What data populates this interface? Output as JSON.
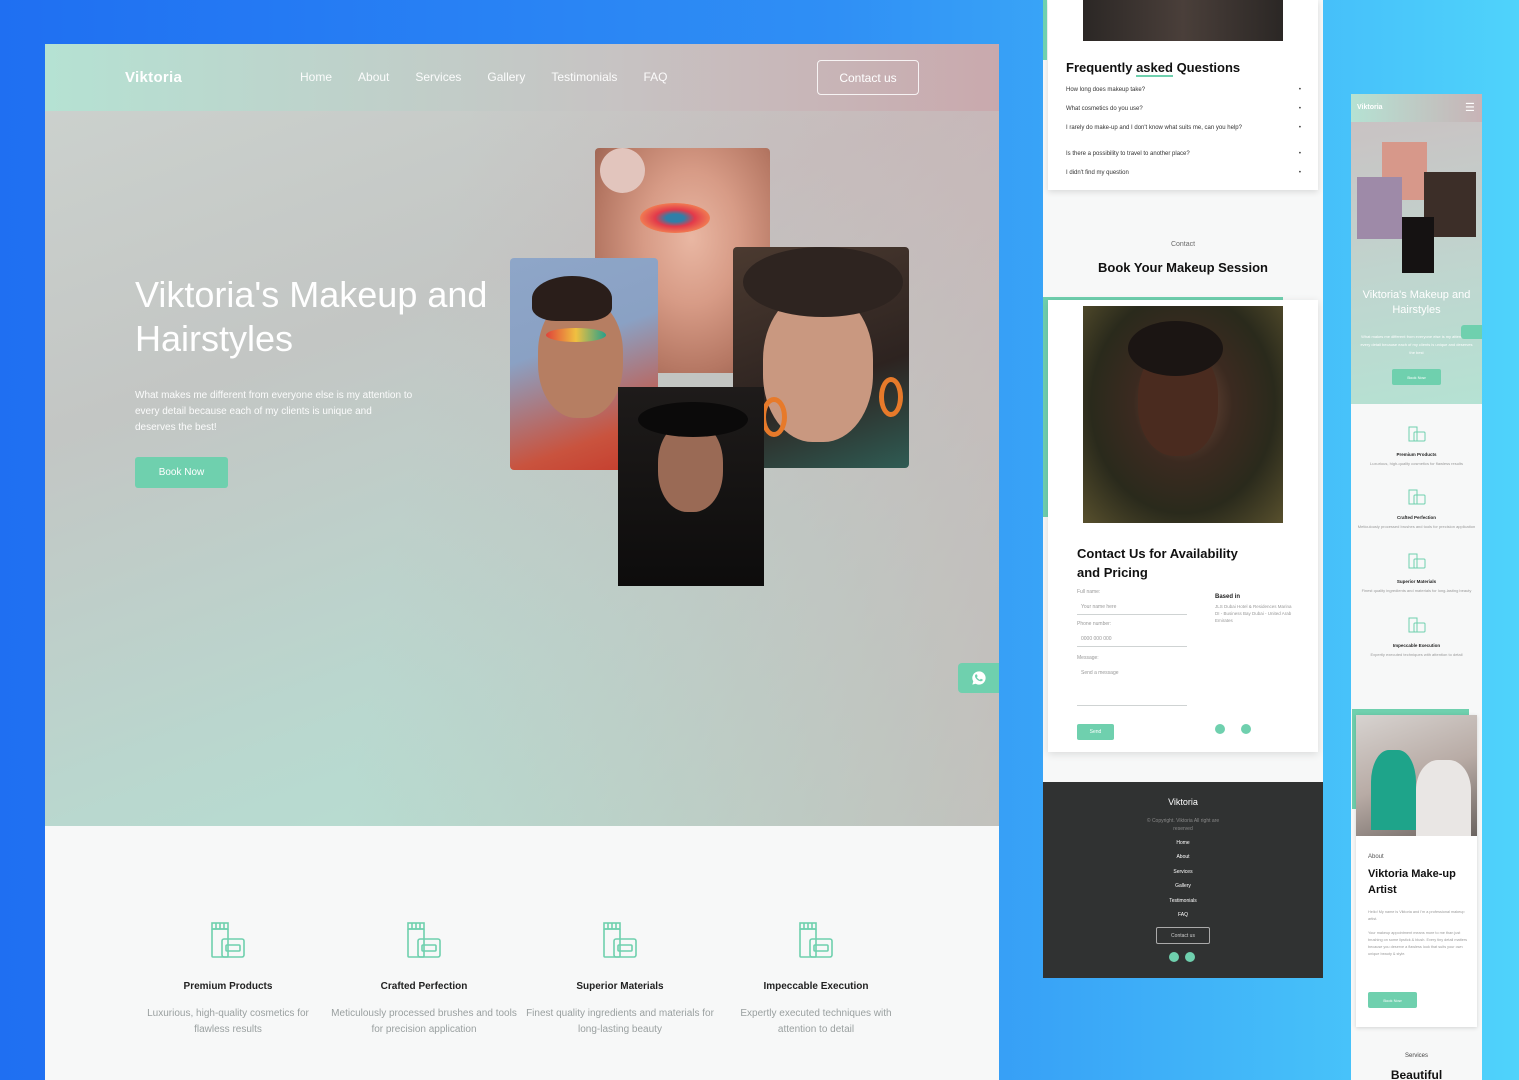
{
  "desktop": {
    "brand": "Viktoria",
    "nav": [
      "Home",
      "About",
      "Services",
      "Gallery",
      "Testimonials",
      "FAQ"
    ],
    "contact_button": "Contact us",
    "hero_title": "Viktoria's Makeup and Hairstyles",
    "hero_subtitle": "What makes me different from everyone else is my attention to every detail because each of my clients is unique and deserves the best!",
    "book_button": "Book Now",
    "features": [
      {
        "title": "Premium Products",
        "text": "Luxurious, high-quality cosmetics for flawless results"
      },
      {
        "title": "Crafted Perfection",
        "text": "Meticulously processed brushes and tools for precision application"
      },
      {
        "title": "Superior Materials",
        "text": "Finest quality ingredients and materials for long-lasting beauty"
      },
      {
        "title": "Impeccable Execution",
        "text": "Expertly executed techniques with attention to detail"
      }
    ]
  },
  "mid": {
    "faq_title_pre": "Frequently ",
    "faq_title_mid": "asked",
    "faq_title_post": " Questions",
    "faq": [
      "How long does makeup take?",
      "What cosmetics do you use?",
      "I rarely do make-up and I don't know what suits me, can you help?",
      "Is there a possibility to travel to another place?",
      "I didn't find my question"
    ],
    "contact_label": "Contact",
    "contact_heading": "Book Your Makeup Session",
    "form_heading": "Contact Us for Availability and Pricing",
    "full_name_label": "Full name:",
    "full_name_placeholder": "Your name here",
    "phone_label": "Phone number:",
    "phone_placeholder": "0000 000 000",
    "message_label": "Message:",
    "message_placeholder": "Send a message",
    "send_button": "Send",
    "based_in_label": "Based in",
    "based_in_text": "JLS Dubai Hotel & Residences Marina DI - Business Bay Dubai - United Arab Emirates",
    "footer_brand": "Viktoria",
    "footer_copyright": "© Copyright. Viktoria All right are reserved",
    "footer_nav": [
      "Home",
      "About",
      "Services",
      "Gallery",
      "Testimonials",
      "FAQ"
    ],
    "footer_contact_button": "Contact us"
  },
  "mobile": {
    "brand": "Viktoria",
    "hero_title": "Viktoria's Makeup and Hairstyles",
    "hero_subtitle": "What makes me different from everyone else is my attention to every detail because each of my clients is unique and deserves the best",
    "book_button": "Book Now",
    "features": [
      {
        "title": "Premium Products",
        "text": "Luxurious, high-quality cosmetics for flawless results"
      },
      {
        "title": "Crafted Perfection",
        "text": "Meticulously processed brushes and tools for precision application"
      },
      {
        "title": "Superior Materials",
        "text": "Finest quality ingredients and materials for long-lasting beauty"
      },
      {
        "title": "Impeccable Execution",
        "text": "Expertly executed techniques with attention to detail"
      }
    ],
    "about_label": "About",
    "about_heading": "Viktoria Make-up Artist",
    "about_text_1": "Hello! My name is Viktoria and I'm a professional makeup artist.",
    "about_text_2": "Your makeup appointment means more to me than just brushing on some lipstick & blush. Every tiny detail matters because you deserve a flawless look that suits your own unique beauty & style.",
    "about_button": "Book Now",
    "services_label": "Services",
    "services_heading": "Beautiful"
  },
  "colors": {
    "accent": "#6fd0ae",
    "footer": "#303232",
    "bg_left": "#1f6ff2",
    "bg_right": "#4fd3fb"
  },
  "icons": [
    "whatsapp-icon",
    "telegram-icon",
    "cosmetics-icon",
    "hamburger-icon"
  ]
}
